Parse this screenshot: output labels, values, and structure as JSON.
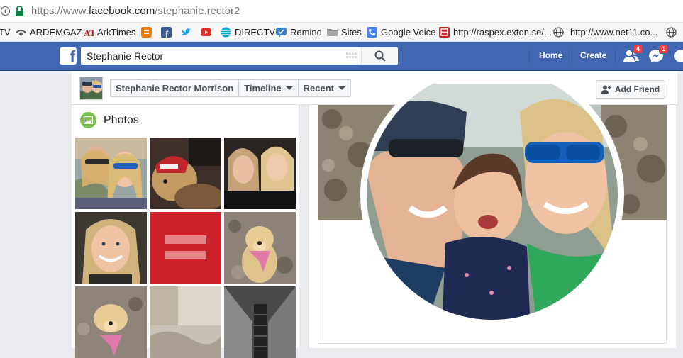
{
  "browser": {
    "url_prefix": "https://www.",
    "url_domain": "facebook.com",
    "url_path": "/stephanie.rector2",
    "bookmarks": [
      {
        "label": "TV",
        "icon": "none-icon"
      },
      {
        "label": "ARDEMGAZ",
        "icon": "ardemgaz-icon"
      },
      {
        "label": "ArkTimes",
        "icon": "arktimes-icon"
      },
      {
        "label": "",
        "icon": "blogger-icon"
      },
      {
        "label": "",
        "icon": "facebook-icon"
      },
      {
        "label": "",
        "icon": "twitter-icon"
      },
      {
        "label": "",
        "icon": "youtube-icon"
      },
      {
        "label": "DIRECTV",
        "icon": "att-icon"
      },
      {
        "label": "Remind",
        "icon": "remind-icon"
      },
      {
        "label": "Sites",
        "icon": "folder-icon"
      },
      {
        "label": "Google Voice",
        "icon": "phone-icon"
      },
      {
        "label": "http://raspex.exton.se/...",
        "icon": "raspex-icon"
      },
      {
        "label": "http://www.net11.co...",
        "icon": "globe-icon"
      },
      {
        "label": "",
        "icon": "globe-icon"
      }
    ]
  },
  "fb": {
    "search_value": "Stephanie Rector",
    "nav": {
      "home": "Home",
      "create": "Create"
    },
    "badges": {
      "friends": "4",
      "messages": "1"
    },
    "colors": {
      "brand": "#4267b2",
      "badge": "#fa3e3e",
      "photos_icon": "#7bc04e"
    }
  },
  "profile": {
    "name": "Stephanie Rector Morrison",
    "timeline_label": "Timeline",
    "recent_label": "Recent",
    "add_friend_label": "Add Friend"
  },
  "photos": {
    "title": "Photos",
    "tiles": [
      "selfie-two-women",
      "dog-in-hat",
      "two-women-night",
      "woman-smiling",
      "equality-logo",
      "yellow-lab-dog",
      "yellow-lab-bandana",
      "pillow-text",
      "escalator-bw"
    ]
  }
}
